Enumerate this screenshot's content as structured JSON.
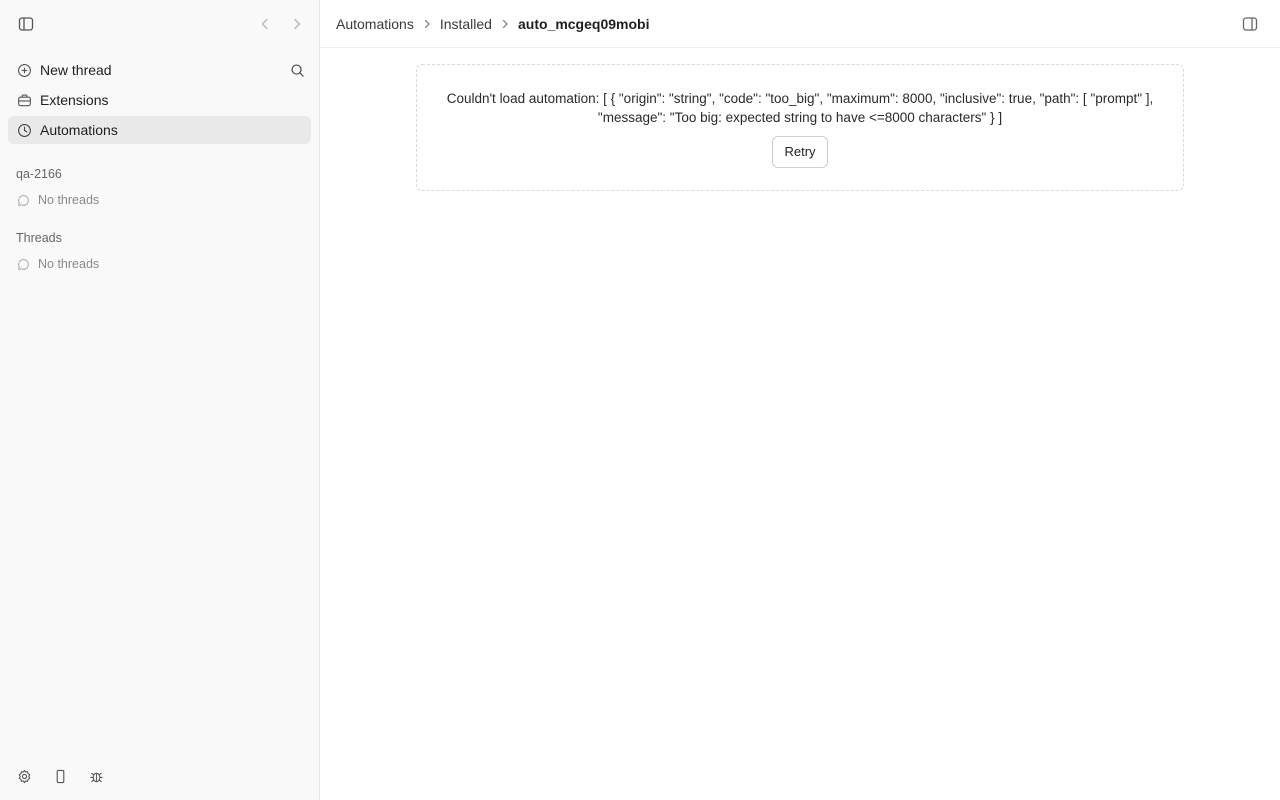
{
  "sidebar": {
    "toggle_icon": "sidebar-toggle-icon",
    "back_icon": "chevron-left-icon",
    "forward_icon": "chevron-right-icon",
    "nav": [
      {
        "label": "New thread",
        "icon": "plus-circle-icon"
      },
      {
        "label": "Extensions",
        "icon": "briefcase-icon"
      },
      {
        "label": "Automations",
        "icon": "clock-icon",
        "active": true
      }
    ],
    "search_icon": "search-icon",
    "groups": [
      {
        "title": "qa-2166",
        "empty_text": "No threads"
      },
      {
        "title": "Threads",
        "empty_text": "No threads"
      }
    ],
    "bottom_icons": [
      "gear-icon",
      "phone-icon",
      "bug-icon"
    ]
  },
  "header": {
    "breadcrumb": [
      "Automations",
      "Installed",
      "auto_mcgeq09mobi"
    ],
    "right_panel_icon": "panel-right-icon"
  },
  "error": {
    "message": "Couldn't load automation: [ { \"origin\": \"string\", \"code\": \"too_big\", \"maximum\": 8000, \"inclusive\": true, \"path\": [ \"prompt\" ], \"message\": \"Too big: expected string to have <=8000 characters\" } ]",
    "retry_label": "Retry"
  }
}
